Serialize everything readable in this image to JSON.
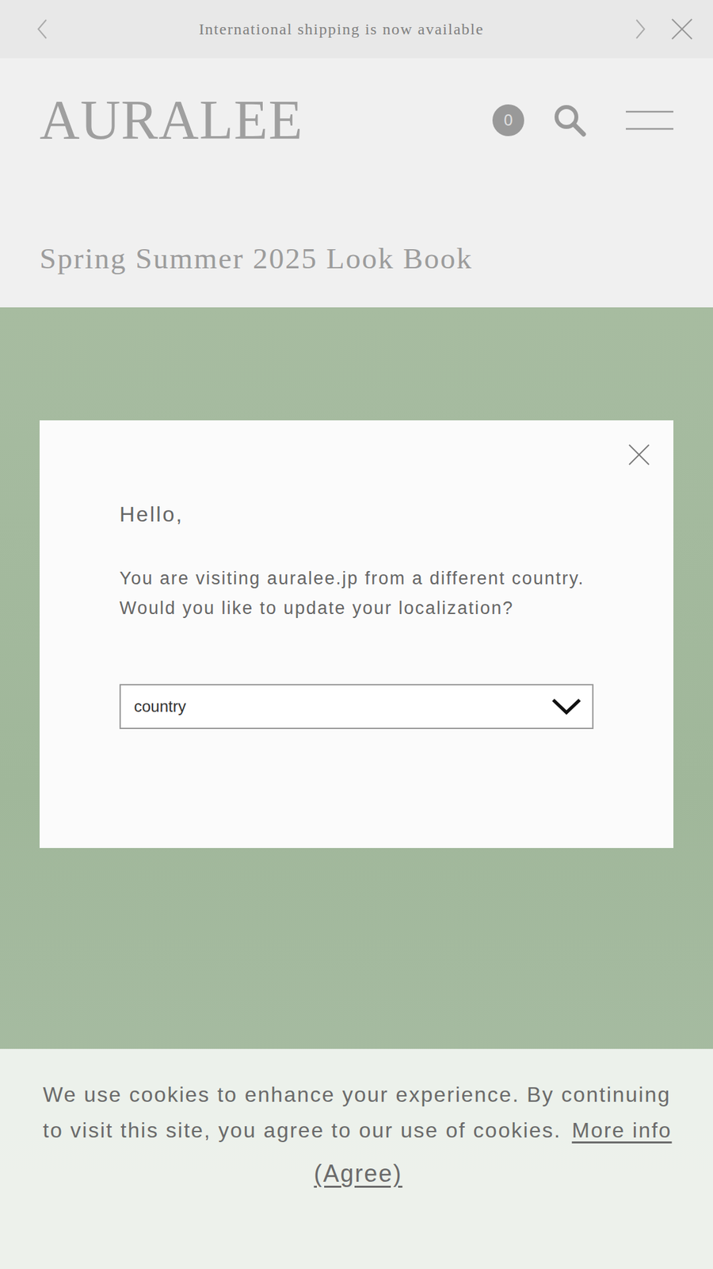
{
  "announcement": {
    "text": "International shipping is now available"
  },
  "header": {
    "logo": "AURALEE",
    "cart_count": "0"
  },
  "page": {
    "title": "Spring Summer 2025 Look Book"
  },
  "modal": {
    "greeting": "Hello,",
    "message": [
      "You are visiting auralee.jp from a different country.",
      "Would you like to update your localization?"
    ],
    "select": {
      "placeholder": "country"
    }
  },
  "cookie_banner": {
    "text": "We use cookies to enhance your experience. By continuing to visit this site, you agree to our use of cookies.",
    "link": "More info",
    "button": "(Agree)"
  }
}
